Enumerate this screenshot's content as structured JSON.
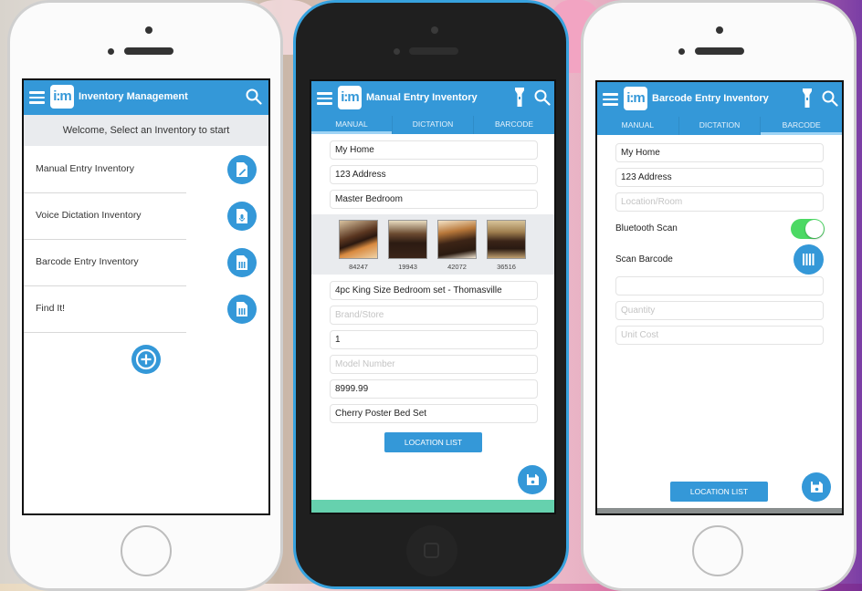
{
  "colors": {
    "brand_blue": "#3498d8",
    "toggle_green": "#4cd964",
    "footer_green": "#66d1ae",
    "header_gray": "#e9ebee"
  },
  "app": {
    "logo_text": "i:m"
  },
  "phone1": {
    "title": "Inventory Management",
    "welcome": "Welcome, Select an Inventory to start",
    "items": [
      {
        "label": "Manual Entry Inventory",
        "icon": "edit-document-icon"
      },
      {
        "label": "Voice Dictation Inventory",
        "icon": "microphone-document-icon"
      },
      {
        "label": "Barcode Entry Inventory",
        "icon": "barcode-document-icon"
      },
      {
        "label": "Find It!",
        "icon": "barcode-document-icon"
      }
    ]
  },
  "tabs": [
    "MANUAL",
    "DICTATION",
    "BARCODE"
  ],
  "phone2": {
    "title": "Manual Entry Inventory",
    "active_tab": "MANUAL",
    "fields_top": [
      {
        "value": "My Home",
        "placeholder": ""
      },
      {
        "value": "123 Address",
        "placeholder": ""
      },
      {
        "value": "Master Bedroom",
        "placeholder": ""
      }
    ],
    "thumbnails": [
      {
        "label": "84247"
      },
      {
        "label": "19943"
      },
      {
        "label": "42072"
      },
      {
        "label": "36516"
      }
    ],
    "fields_bottom": [
      {
        "value": "4pc King Size Bedroom set - Thomasville",
        "placeholder": ""
      },
      {
        "value": "",
        "placeholder": "Brand/Store"
      },
      {
        "value": "1",
        "placeholder": ""
      },
      {
        "value": "",
        "placeholder": "Model Number"
      },
      {
        "value": "8999.99",
        "placeholder": ""
      },
      {
        "value": "Cherry Poster Bed Set",
        "placeholder": ""
      }
    ],
    "location_button": "LOCATION LIST"
  },
  "phone3": {
    "title": "Barcode Entry Inventory",
    "active_tab": "BARCODE",
    "fields": [
      {
        "value": "My Home",
        "placeholder": ""
      },
      {
        "value": "123 Address",
        "placeholder": ""
      },
      {
        "value": "",
        "placeholder": "Location/Room"
      }
    ],
    "bluetooth_label": "Bluetooth Scan",
    "bluetooth_on": true,
    "scan_label": "Scan Barcode",
    "fields_lower": [
      {
        "value": "",
        "placeholder": ""
      },
      {
        "value": "",
        "placeholder": "Quantity"
      },
      {
        "value": "",
        "placeholder": "Unit Cost"
      }
    ],
    "location_button": "LOCATION LIST"
  }
}
